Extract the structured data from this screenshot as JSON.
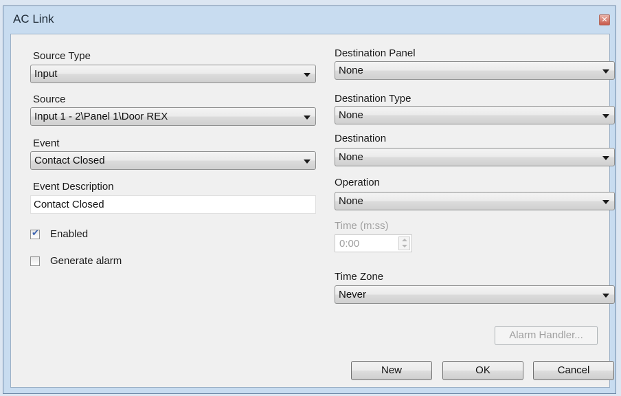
{
  "window": {
    "title": "AC Link"
  },
  "left": {
    "source_type": {
      "label": "Source Type",
      "value": "Input"
    },
    "source": {
      "label": "Source",
      "value": "Input 1 - 2\\Panel 1\\Door REX"
    },
    "event": {
      "label": "Event",
      "value": "Contact Closed"
    },
    "event_description": {
      "label": "Event Description",
      "value": "Contact Closed"
    },
    "enabled": {
      "label": "Enabled",
      "checked": true
    },
    "generate_alarm": {
      "label": "Generate alarm",
      "checked": false
    }
  },
  "right": {
    "destination_panel": {
      "label": "Destination Panel",
      "value": "None"
    },
    "destination_type": {
      "label": "Destination Type",
      "value": "None"
    },
    "destination": {
      "label": "Destination",
      "value": "None"
    },
    "operation": {
      "label": "Operation",
      "value": "None"
    },
    "time": {
      "label": "Time (m:ss)",
      "value": "0:00"
    },
    "time_zone": {
      "label": "Time Zone",
      "value": "Never"
    }
  },
  "buttons": {
    "alarm_handler": "Alarm Handler...",
    "new": "New",
    "ok": "OK",
    "cancel": "Cancel"
  },
  "colors": {
    "window_frame": "#c8dcf0",
    "client_bg": "#f0f0f0",
    "check_mark": "#3a62b0"
  },
  "icons": {
    "close": "close-icon",
    "dropdown": "chevron-down-icon",
    "check": "checkmark-icon"
  }
}
